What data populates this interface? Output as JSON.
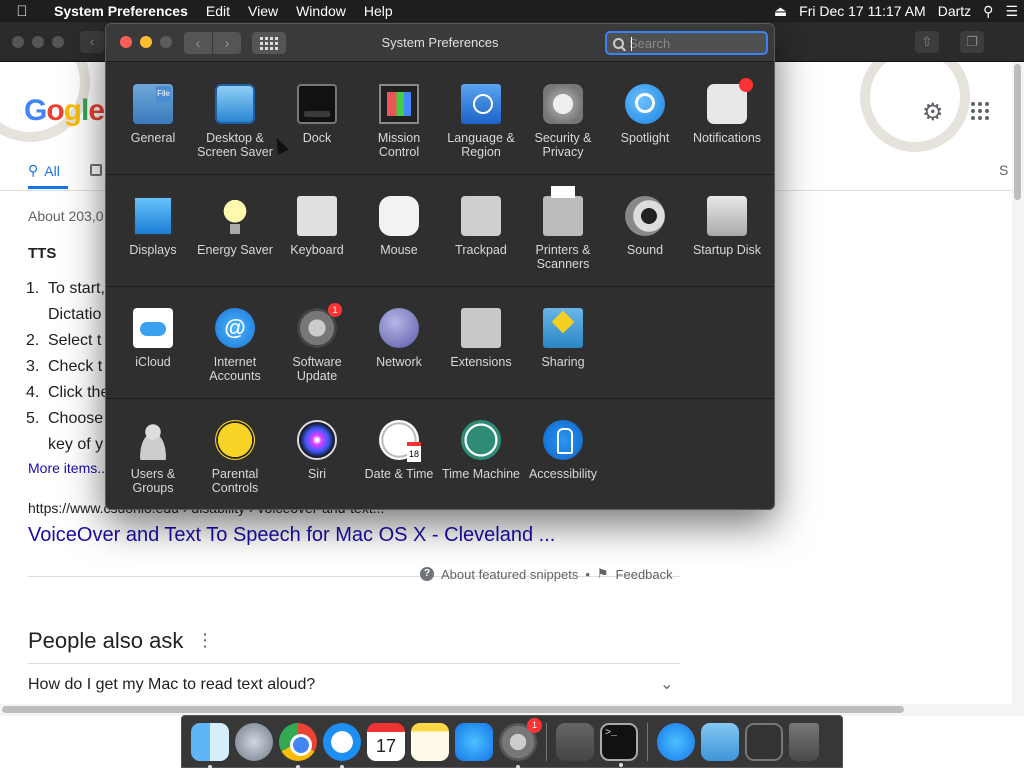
{
  "menubar": {
    "app_name": "System Preferences",
    "menus": [
      "Edit",
      "View",
      "Window",
      "Help"
    ],
    "clock": "Fri Dec 17  11:17 AM",
    "user": "Dartz"
  },
  "google": {
    "logo_text": "Google",
    "tab_all": "All",
    "result_count": "About 203,0",
    "snippet_heading": "TTS",
    "list": [
      {
        "num": "1.",
        "text": "To start,"
      },
      {
        "num": "",
        "text": "Dictatio"
      },
      {
        "num": "2.",
        "text": "Select t"
      },
      {
        "num": "3.",
        "text": "Check t"
      },
      {
        "num": "4.",
        "text": "Click the"
      },
      {
        "num": "5.",
        "text": "Choose"
      },
      {
        "num": "",
        "text": "key of y"
      }
    ],
    "more_items": "More items...",
    "result_url": "https://www.csuohio.edu › disability › voiceover-and-text...",
    "result_title": "VoiceOver and Text To Speech for Mac OS X - Cleveland ...",
    "about_snippets": "About featured snippets",
    "feedback": "Feedback",
    "people_also_ask": "People also ask",
    "paa_question": "How do I get my Mac to read text aloud?",
    "right_tab_partial": "S"
  },
  "sysprefs": {
    "title": "System Preferences",
    "search_placeholder": "Search",
    "rows": [
      [
        {
          "icon": "general-icon",
          "label": "General"
        },
        {
          "icon": "desktop-screensaver-icon",
          "label": "Desktop & Screen Saver"
        },
        {
          "icon": "dock-icon",
          "label": "Dock"
        },
        {
          "icon": "mission-control-icon",
          "label": "Mission Control"
        },
        {
          "icon": "language-region-icon",
          "label": "Language & Region"
        },
        {
          "icon": "security-privacy-icon",
          "label": "Security & Privacy"
        },
        {
          "icon": "spotlight-icon",
          "label": "Spotlight"
        },
        {
          "icon": "notifications-icon",
          "label": "Notifications"
        }
      ],
      [
        {
          "icon": "displays-icon",
          "label": "Displays"
        },
        {
          "icon": "energy-saver-icon",
          "label": "Energy Saver"
        },
        {
          "icon": "keyboard-icon",
          "label": "Keyboard"
        },
        {
          "icon": "mouse-icon",
          "label": "Mouse"
        },
        {
          "icon": "trackpad-icon",
          "label": "Trackpad"
        },
        {
          "icon": "printers-scanners-icon",
          "label": "Printers & Scanners"
        },
        {
          "icon": "sound-icon",
          "label": "Sound"
        },
        {
          "icon": "startup-disk-icon",
          "label": "Startup Disk"
        }
      ],
      [
        {
          "icon": "icloud-icon",
          "label": "iCloud"
        },
        {
          "icon": "internet-accounts-icon",
          "label": "Internet Accounts"
        },
        {
          "icon": "software-update-icon",
          "label": "Software Update",
          "badge": "1"
        },
        {
          "icon": "network-icon",
          "label": "Network"
        },
        {
          "icon": "extensions-icon",
          "label": "Extensions"
        },
        {
          "icon": "sharing-icon",
          "label": "Sharing"
        }
      ],
      [
        {
          "icon": "users-groups-icon",
          "label": "Users & Groups"
        },
        {
          "icon": "parental-controls-icon",
          "label": "Parental Controls"
        },
        {
          "icon": "siri-icon",
          "label": "Siri"
        },
        {
          "icon": "date-time-icon",
          "label": "Date & Time"
        },
        {
          "icon": "time-machine-icon",
          "label": "Time Machine"
        },
        {
          "icon": "accessibility-icon",
          "label": "Accessibility"
        }
      ]
    ]
  },
  "dock": {
    "calendar_month": "DEC",
    "calendar_day": "17",
    "sysprefs_badge": "1",
    "terminal_prompt": ">_"
  }
}
